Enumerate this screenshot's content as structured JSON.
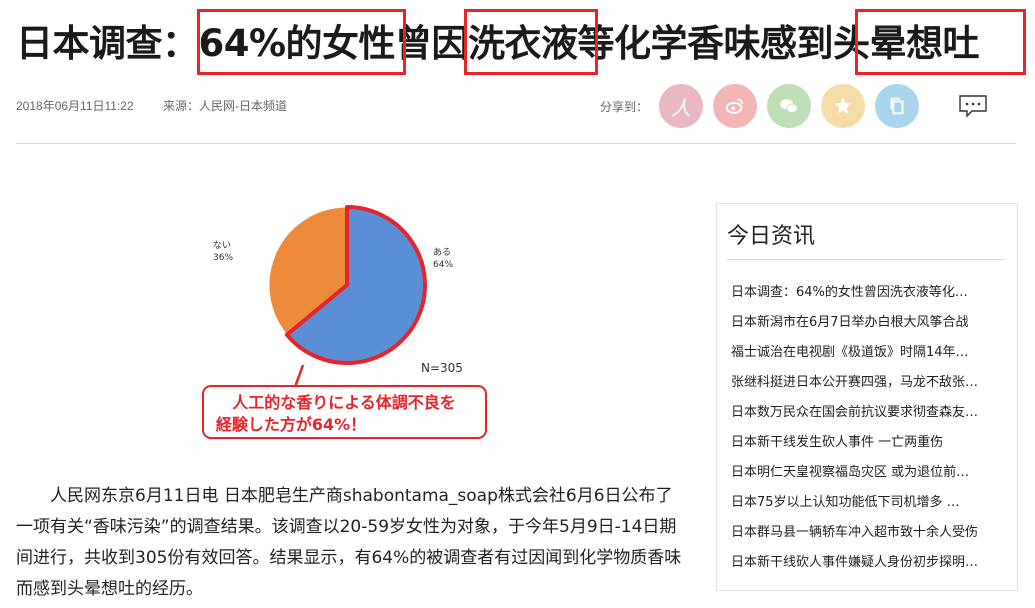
{
  "article": {
    "headline": "日本调查：64%的女性曾因洗衣液等化学香味感到头晕想吐",
    "date": "2018年06月11日11:22",
    "source": "来源：人民网-日本频道",
    "body": "人民网东京6月11日电 日本肥皂生产商shabontama_soap株式会社6月6日公布了一项有关“香味污染”的调查结果。该调查以20-59岁女性为对象，于今年5月9日-14日期间进行，共收到305份有效回答。结果显示，有64%的被调查者有过因闻到化学物质香味而感到头晕想吐的经历。"
  },
  "share": {
    "label": "分享到：",
    "buttons": [
      {
        "name": "renren",
        "color": "#e9b8c2",
        "glyph": "人"
      },
      {
        "name": "weibo",
        "color": "#f3b6b6",
        "glyph": "weibo"
      },
      {
        "name": "wechat",
        "color": "#bfe0b6",
        "glyph": "wechat"
      },
      {
        "name": "qzone",
        "color": "#f6dca6",
        "glyph": "star"
      },
      {
        "name": "copy",
        "color": "#a9d6ec",
        "glyph": "copy"
      }
    ]
  },
  "chart_data": {
    "type": "pie",
    "categories": [
      "ある",
      "ない"
    ],
    "values": [
      64,
      36
    ],
    "labels": [
      {
        "text": "ある",
        "pct": "64%"
      },
      {
        "text": "ない",
        "pct": "36%"
      }
    ],
    "colors": [
      "#5a8fd6",
      "#ee8a3c"
    ],
    "highlight_color": "#e8232a",
    "n_label": "N=305",
    "callout_line1": "人工的な香りによる体調不良を",
    "callout_line2": "経験した方が64%！"
  },
  "sidebar": {
    "title": "今日资讯",
    "items": [
      "日本调查：64%的女性曾因洗衣液等化…",
      "日本新潟市在6月7日举办白根大风筝合战",
      "福士诚治在电视剧《极道饭》时隔14年…",
      "张继科挺进日本公开赛四强，马龙不敌张…",
      "日本数万民众在国会前抗议要求彻查森友…",
      "日本新干线发生砍人事件 一亡两重伤",
      "日本明仁天皇视察福岛灾区 或为退位前…",
      "日本75岁以上认知功能低下司机增多 …",
      "日本群马县一辆轿车冲入超市致十余人受伤",
      "日本新干线砍人事件嫌疑人身份初步探明…"
    ]
  }
}
